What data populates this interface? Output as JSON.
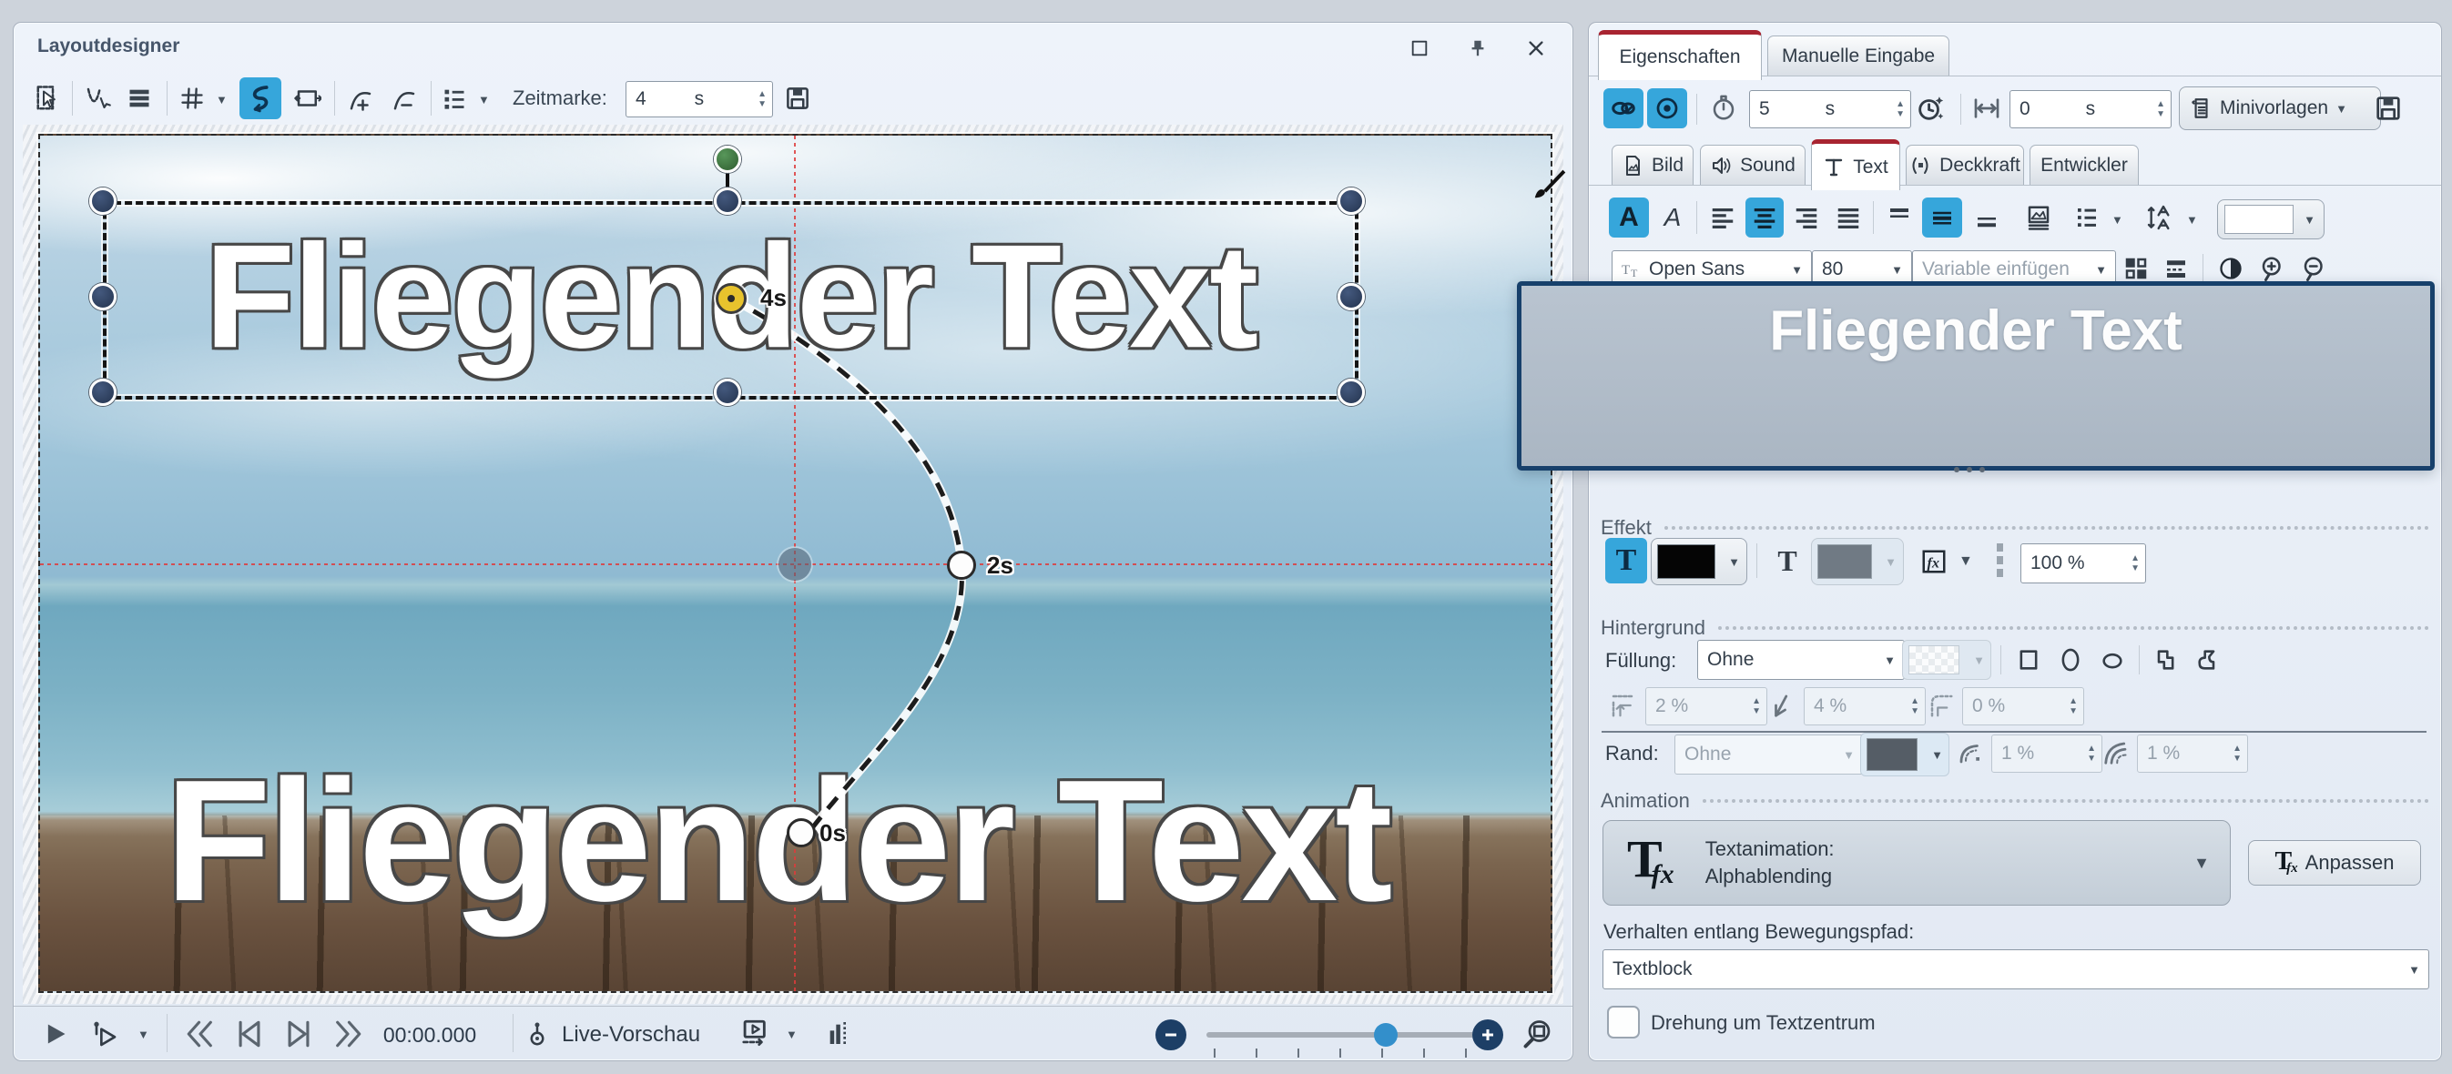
{
  "window": {
    "title": "Layoutdesigner"
  },
  "left": {
    "toolbar": {
      "zeitmarke_label": "Zeitmarke:",
      "zeitmarke_value": "4",
      "zeitmarke_unit": "s"
    },
    "canvas": {
      "text_top": "Fliegender Text",
      "text_bottom": "Fliegender Text",
      "marker_4s": "4s",
      "marker_2s": "2s",
      "marker_0s": "0s"
    },
    "playback": {
      "time": "00:00.000",
      "live_label": "Live-Vorschau"
    }
  },
  "right": {
    "tabs": [
      {
        "label": "Eigenschaften"
      },
      {
        "label": "Manuelle Eingabe"
      }
    ],
    "toolbar": {
      "duration_value": "5",
      "duration_unit": "s",
      "offset_value": "0",
      "offset_unit": "s",
      "minivorlagen_label": "Minivorlagen"
    },
    "content_tabs": [
      {
        "label": "Bild"
      },
      {
        "label": "Sound"
      },
      {
        "label": "Text"
      },
      {
        "label": "Deckkraft"
      },
      {
        "label": "Entwickler"
      }
    ],
    "font": {
      "family": "Open Sans",
      "size": "80",
      "variable_placeholder": "Variable einfügen"
    },
    "preview": {
      "text": "Fliegender Text"
    },
    "effekt": {
      "heading": "Effekt",
      "opacity": "100 %"
    },
    "hintergrund": {
      "heading": "Hintergrund",
      "fuellung_label": "Füllung:",
      "fuellung_value": "Ohne",
      "padding_value": "2 %",
      "angle_value": "4 %",
      "corner_value": "0 %",
      "rand_label": "Rand:",
      "rand_value": "Ohne",
      "rand_width1": "1 %",
      "rand_width2": "1 %"
    },
    "animation": {
      "heading": "Animation",
      "dropdown_line1": "Textanimation:",
      "dropdown_line2": "Alphablending",
      "anpassen_label": "Anpassen",
      "verhalten_label": "Verhalten entlang Bewegungspfad:",
      "verhalten_value": "Textblock",
      "checkbox_label": "Drehung um Textzentrum"
    }
  },
  "colors": {
    "accent_blue": "#36a6db",
    "tab_red": "#a82431",
    "handle_navy": "#2c3e5d",
    "rotate_green": "#3e7c3f",
    "marker_yellow": "#e8c32d",
    "guide_red": "#dd3b3b",
    "preview_border": "#17406b"
  }
}
